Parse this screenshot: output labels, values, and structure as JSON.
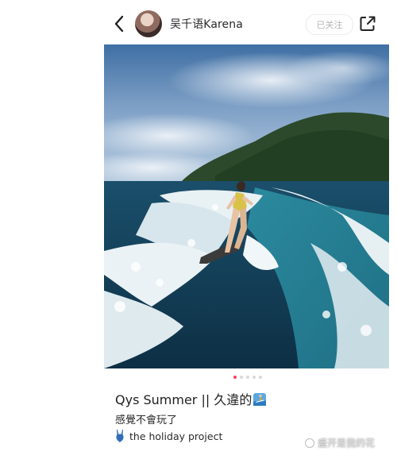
{
  "header": {
    "username": "吴千语Karena",
    "follow_label": "已关注"
  },
  "carousel": {
    "total": 5,
    "active_index": 0
  },
  "post": {
    "title": "Qys Summer || 久違的",
    "body": "感覺不會玩了",
    "project": "the holiday project"
  },
  "watermark": {
    "text": "盛开是我的花"
  },
  "icons": {
    "back": "chevron-left-icon",
    "share": "share-icon",
    "surf": "surfer-emoji-icon",
    "swimsuit": "swimsuit-emoji-icon"
  },
  "colors": {
    "accent": "#ff3b5c",
    "sky": "#4f7fb0",
    "sea": "#1f5870"
  }
}
